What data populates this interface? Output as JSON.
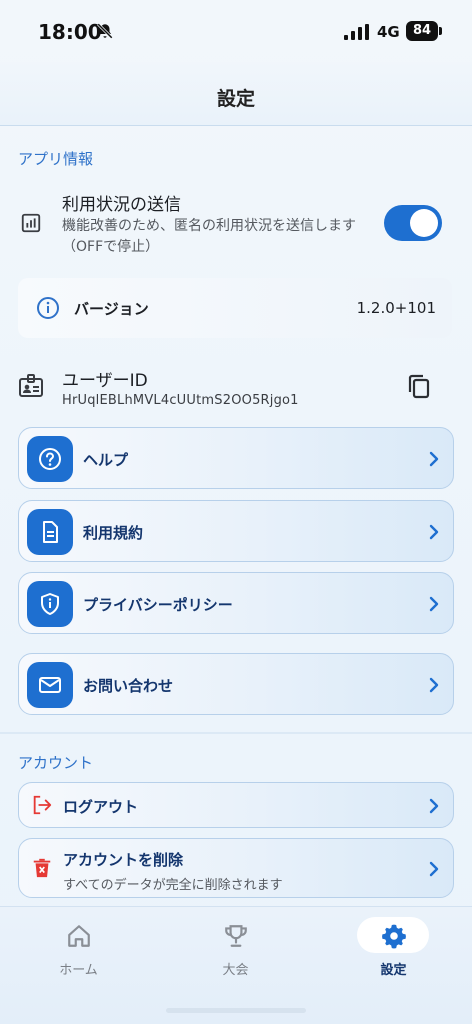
{
  "status_bar": {
    "time": "18:00",
    "network": "4G",
    "battery": "84"
  },
  "header": {
    "title": "設定"
  },
  "app_info": {
    "section_label": "アプリ情報",
    "usage": {
      "title": "利用状況の送信",
      "description": "機能改善のため、匿名の利用状況を送信します（OFFで停止）",
      "enabled": true
    },
    "version": {
      "label": "バージョン",
      "value": "1.2.0+101"
    },
    "user_id": {
      "label": "ユーザーID",
      "value": "HrUqlEBLhMVL4cUUtmS2OO5Rjgo1"
    }
  },
  "menu": [
    {
      "label": "ヘルプ",
      "icon": "help-circle-icon"
    },
    {
      "label": "利用規約",
      "icon": "document-icon"
    },
    {
      "label": "プライバシーポリシー",
      "icon": "shield-info-icon"
    },
    {
      "label": "お問い合わせ",
      "icon": "mail-icon"
    }
  ],
  "account": {
    "section_label": "アカウント",
    "logout": {
      "label": "ログアウト",
      "icon": "logout-icon"
    },
    "delete": {
      "label": "アカウントを削除",
      "description": "すべてのデータが完全に削除されます",
      "icon": "trash-icon"
    }
  },
  "tabbar": {
    "tabs": [
      {
        "label": "ホーム",
        "icon": "home-icon",
        "active": false
      },
      {
        "label": "大会",
        "icon": "trophy-icon",
        "active": false
      },
      {
        "label": "設定",
        "icon": "gear-icon",
        "active": true
      }
    ]
  },
  "colors": {
    "accent": "#1e6fd0",
    "section": "#2f72c9",
    "card_text": "#14366e",
    "danger": "#e53935"
  }
}
